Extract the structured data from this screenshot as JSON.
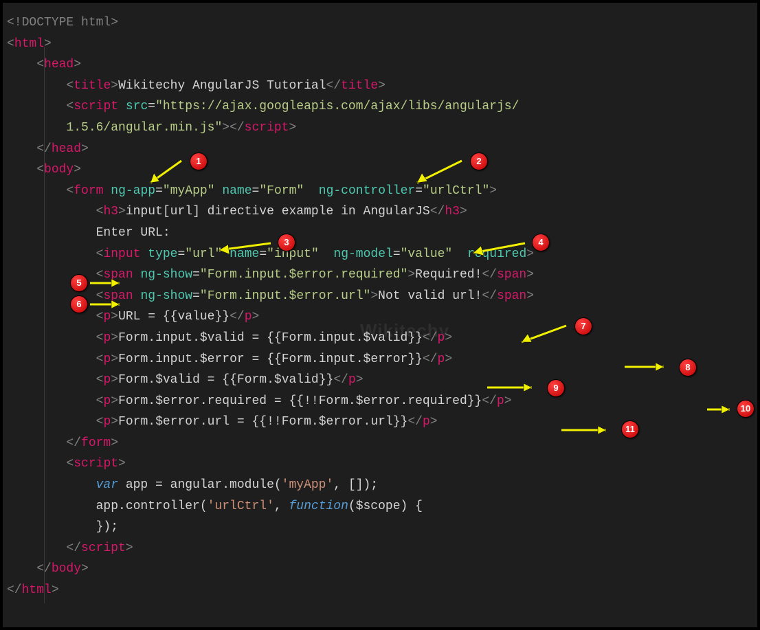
{
  "code": {
    "line1_doctype": "<!DOCTYPE html>",
    "title_text": "Wikitechy AngularJS Tutorial",
    "script_src": "\"https://ajax.googleapis.com/ajax/libs/angularjs/",
    "script_src2": "        1.5.6/angular.min.js\"",
    "form_app": "\"myApp\"",
    "form_name": "\"Form\"",
    "form_ctrl": "\"urlCtrl\"",
    "h3_text": "input[url] directive example in AngularJS",
    "enter_url": "            Enter URL:",
    "input_type": "\"url\"",
    "input_name": "\"input\"",
    "input_model": "\"value\"",
    "ngshow_req": "\"Form.input.$error.required\"",
    "required_text": "Required!",
    "ngshow_url": "\"Form.input.$error.url\"",
    "notvalid_text": "Not valid url!",
    "p1": "URL = {{value}}",
    "p2": "Form.input.$valid = {{Form.input.$valid}}",
    "p3": "Form.input.$error = {{Form.input.$error}}",
    "p4": "Form.$valid = {{Form.$valid}}",
    "p5": "Form.$error.required = {{!!Form.$error.required}}",
    "p6": "Form.$error.url = {{!!Form.$error.url}}",
    "js_var": "var",
    "js_line1a": " app = angular.module(",
    "js_str1": "'myApp'",
    "js_line1b": ", []);",
    "js_line2a": "            app.controller(",
    "js_str2": "'urlCtrl'",
    "js_line2b": ", ",
    "js_func": "function",
    "js_line2c": "($scope) {",
    "js_line3": "            });"
  },
  "badges": {
    "b1": "1",
    "b2": "2",
    "b3": "3",
    "b4": "4",
    "b5": "5",
    "b6": "6",
    "b7": "7",
    "b8": "8",
    "b9": "9",
    "b10": "10",
    "b11": "11"
  },
  "watermark": "Wikitechy"
}
